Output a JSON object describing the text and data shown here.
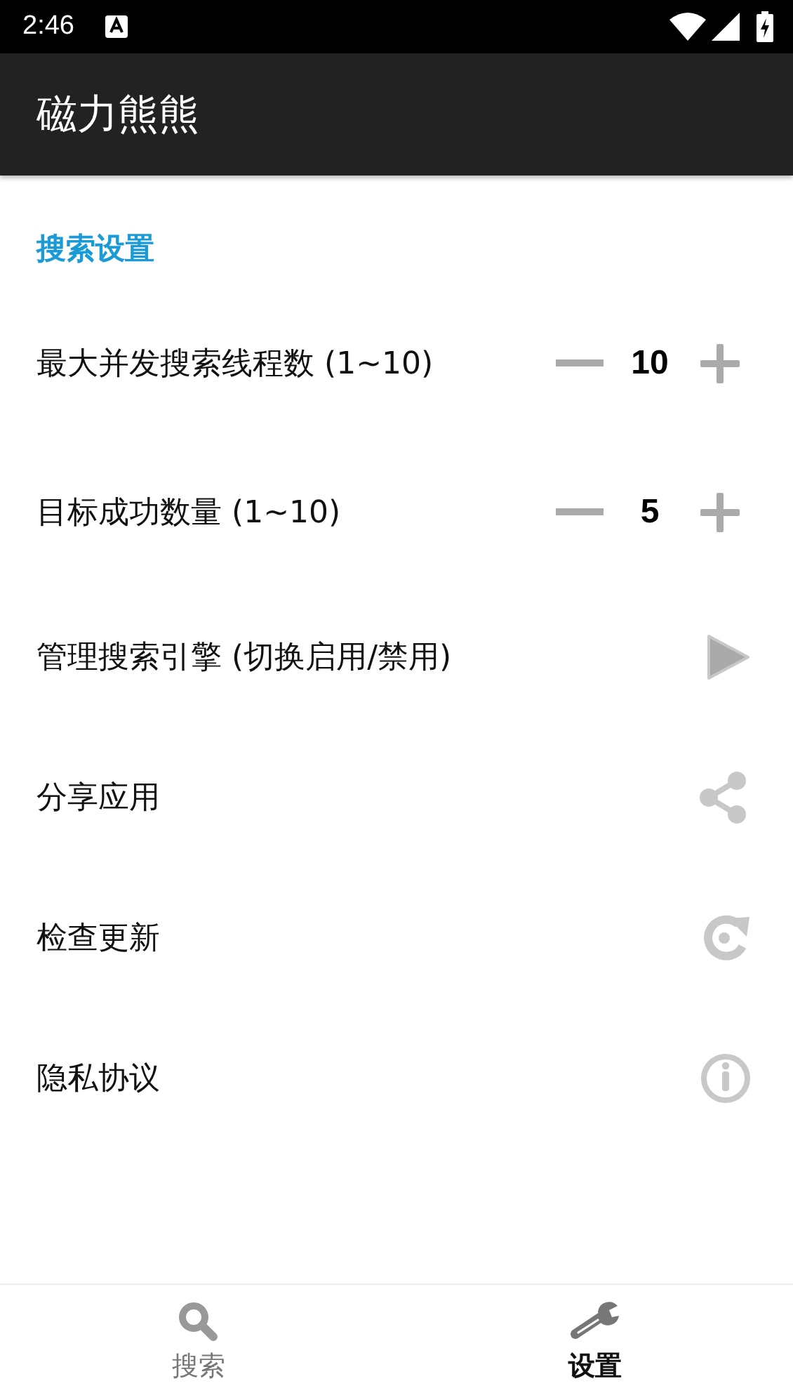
{
  "status_bar": {
    "time": "2:46"
  },
  "app_bar": {
    "title": "磁力熊熊"
  },
  "section": {
    "title": "搜索设置"
  },
  "rows": [
    {
      "kind": "stepper",
      "label": "最大并发搜索线程数 (1~10)",
      "value": "10"
    },
    {
      "kind": "stepper",
      "label": "目标成功数量 (1~10)",
      "value": "5"
    },
    {
      "kind": "play",
      "label": "管理搜索引擎 (切换启用/禁用)"
    },
    {
      "kind": "share",
      "label": "分享应用"
    },
    {
      "kind": "refresh",
      "label": "检查更新"
    },
    {
      "kind": "info",
      "label": "隐私协议"
    }
  ],
  "bottom_nav": [
    {
      "kind": "search",
      "label": "搜索",
      "selected": false
    },
    {
      "kind": "wrench",
      "label": "设置",
      "selected": true
    }
  ]
}
